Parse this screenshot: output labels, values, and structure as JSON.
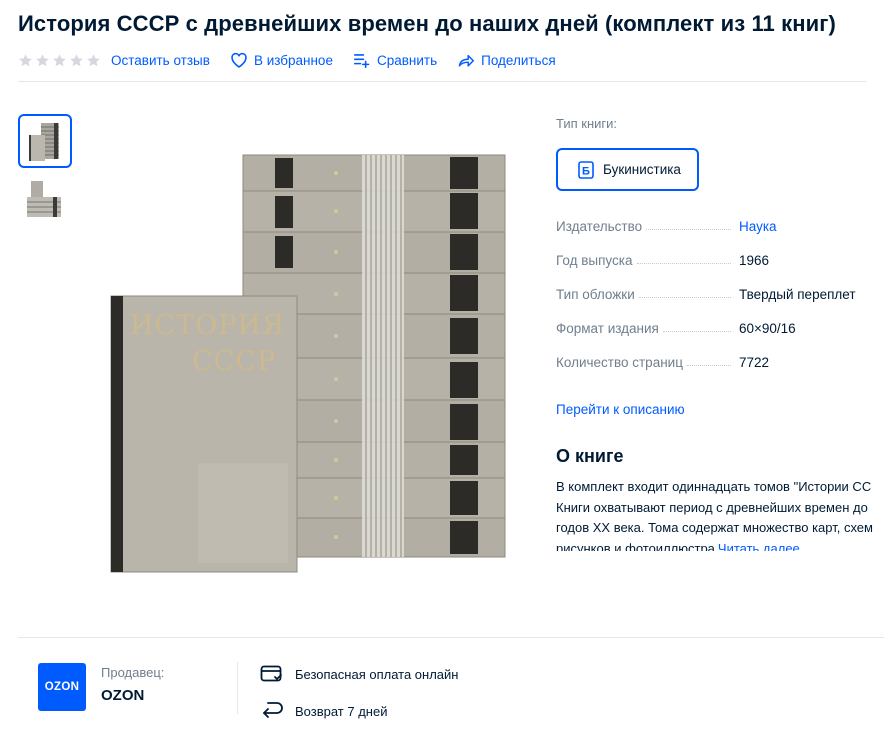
{
  "product": {
    "title": "История СССР с древнейших времен до наших дней (комплект из 11 книг)"
  },
  "actions": {
    "rating_stars": 0,
    "review": "Оставить отзыв",
    "favorite": "В избранное",
    "compare": "Сравнить",
    "share": "Поделиться"
  },
  "gallery": {
    "cover_title_line1": "ИСТОРИЯ",
    "cover_title_line2": "СССР"
  },
  "book_type": {
    "label": "Тип книги:",
    "selected": "Букинистика",
    "chip_letter": "Б"
  },
  "specs": [
    {
      "key": "Издательство",
      "value": "Наука",
      "link": true
    },
    {
      "key": "Год выпуска",
      "value": "1966",
      "link": false
    },
    {
      "key": "Тип обложки",
      "value": "Твердый переплет",
      "link": false
    },
    {
      "key": "Формат издания",
      "value": "60×90/16",
      "link": false
    },
    {
      "key": "Количество страниц",
      "value": "7722",
      "link": false
    }
  ],
  "goto_description": "Перейти к описанию",
  "about": {
    "heading": "О книге",
    "lines": [
      "В комплект входит одиннадцать томов \"Истории СС",
      "Книги охватывают период с древнейших времен до",
      "годов XX века. Тома содержат множество карт, схем",
      "рисунков и фотоиллюстра"
    ],
    "read_more": "Читать далее"
  },
  "seller": {
    "label": "Продавец:",
    "name": "OZON",
    "logo_text": "OZON"
  },
  "perks": {
    "payment": "Безопасная оплата онлайн",
    "return": "Возврат 7 дней"
  },
  "colors": {
    "accent": "#005bff",
    "text": "#001a34",
    "muted": "#707f8d"
  }
}
